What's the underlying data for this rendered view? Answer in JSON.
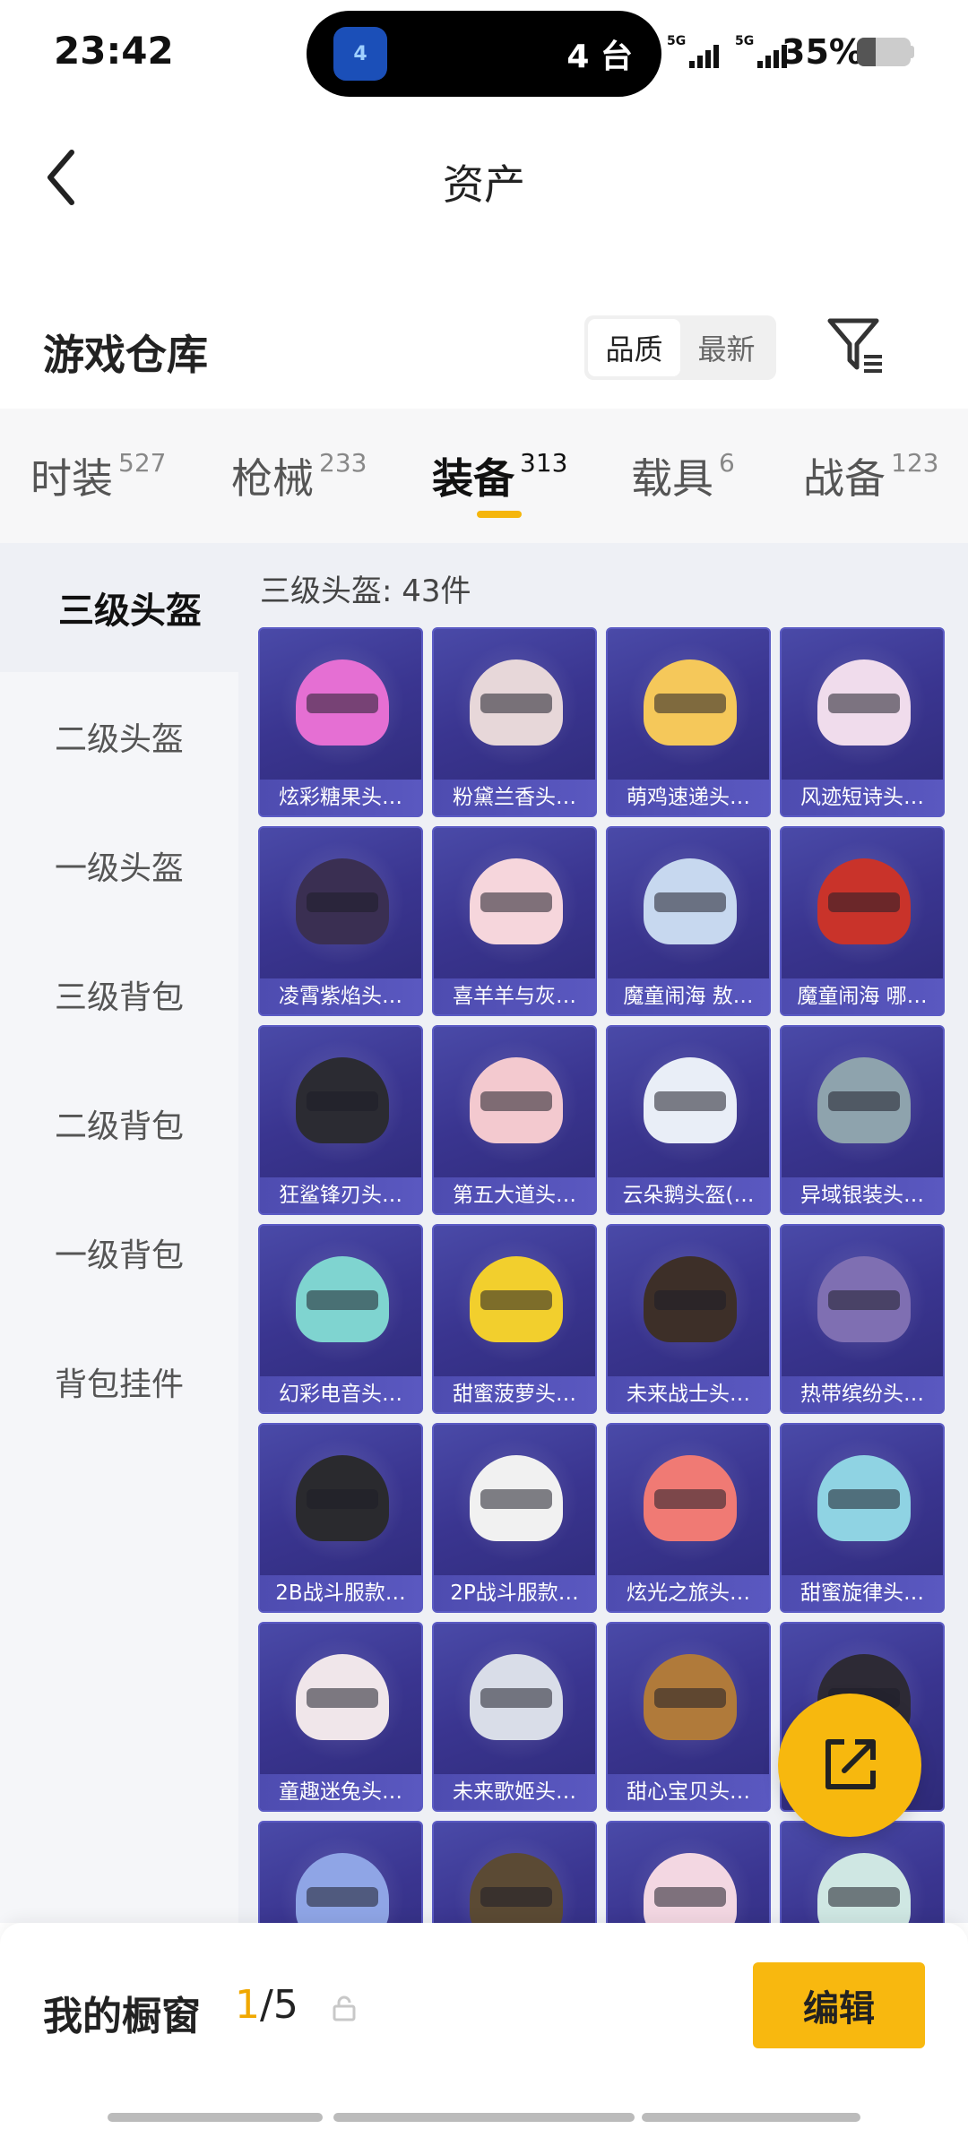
{
  "status_bar": {
    "time": "23:42",
    "island_app": "4",
    "island_text": "4 台",
    "signal_1": "5G",
    "signal_2": "5G",
    "battery": "35%",
    "battery_level": 0.35
  },
  "header": {
    "title": "资产"
  },
  "section": {
    "title": "游戏仓库",
    "sort_options": [
      "品质",
      "最新"
    ],
    "sort_active": "品质"
  },
  "tabs": [
    {
      "label": "时装",
      "count": "527"
    },
    {
      "label": "枪械",
      "count": "233"
    },
    {
      "label": "装备",
      "count": "313",
      "active": true
    },
    {
      "label": "载具",
      "count": "6"
    },
    {
      "label": "战备",
      "count": "123"
    }
  ],
  "sidebar": {
    "items": [
      "三级头盔",
      "二级头盔",
      "一级头盔",
      "三级背包",
      "二级背包",
      "一级背包",
      "背包挂件"
    ],
    "active": "三级头盔"
  },
  "grid": {
    "label": "三级头盔: 43件",
    "items": [
      {
        "name": "炫彩糖果头…",
        "color": "#e56fd3"
      },
      {
        "name": "粉黛兰香头…",
        "color": "#e7d7d9"
      },
      {
        "name": "萌鸡速递头…",
        "color": "#f5c85a"
      },
      {
        "name": "风迹短诗头…",
        "color": "#f0dcec"
      },
      {
        "name": "凌霄紫焰头…",
        "color": "#3a2f52"
      },
      {
        "name": "喜羊羊与灰…",
        "color": "#f6d6dc"
      },
      {
        "name": "魔童闹海 敖…",
        "color": "#c7d8ef"
      },
      {
        "name": "魔童闹海 哪…",
        "color": "#c9332a"
      },
      {
        "name": "狂鲨锋刃头…",
        "color": "#2b2b32"
      },
      {
        "name": "第五大道头…",
        "color": "#f3c9cf"
      },
      {
        "name": "云朵鹅头盔(…",
        "color": "#e9eef7"
      },
      {
        "name": "异域银装头…",
        "color": "#8ea3ad"
      },
      {
        "name": "幻彩电音头…",
        "color": "#7fd4d0"
      },
      {
        "name": "甜蜜菠萝头…",
        "color": "#f2cf2d"
      },
      {
        "name": "未来战士头…",
        "color": "#3d2f28"
      },
      {
        "name": "热带缤纷头…",
        "color": "#7f6fb2"
      },
      {
        "name": "2B战斗服款…",
        "color": "#2a2a2e"
      },
      {
        "name": "2P战斗服款…",
        "color": "#f1f1f1"
      },
      {
        "name": "炫光之旅头…",
        "color": "#f07a74"
      },
      {
        "name": "甜蜜旋律头…",
        "color": "#8fd3e3"
      },
      {
        "name": "童趣迷兔头…",
        "color": "#f0e6ea"
      },
      {
        "name": "未来歌姬头…",
        "color": "#d9dde8"
      },
      {
        "name": "甜心宝贝头…",
        "color": "#b07a3a"
      },
      {
        "name": "",
        "color": "#2d2a35"
      },
      {
        "name": "",
        "color": "#8fa5e6"
      },
      {
        "name": "",
        "color": "#5b4a34"
      },
      {
        "name": "",
        "color": "#f3d7e2"
      },
      {
        "name": "",
        "color": "#cfe7e3"
      }
    ]
  },
  "showcase": {
    "label": "我的橱窗",
    "current": "1",
    "total": "/5",
    "edit_label": "编辑"
  },
  "colors": {
    "accent": "#f8b80f",
    "card_bg": "#3a3590"
  }
}
